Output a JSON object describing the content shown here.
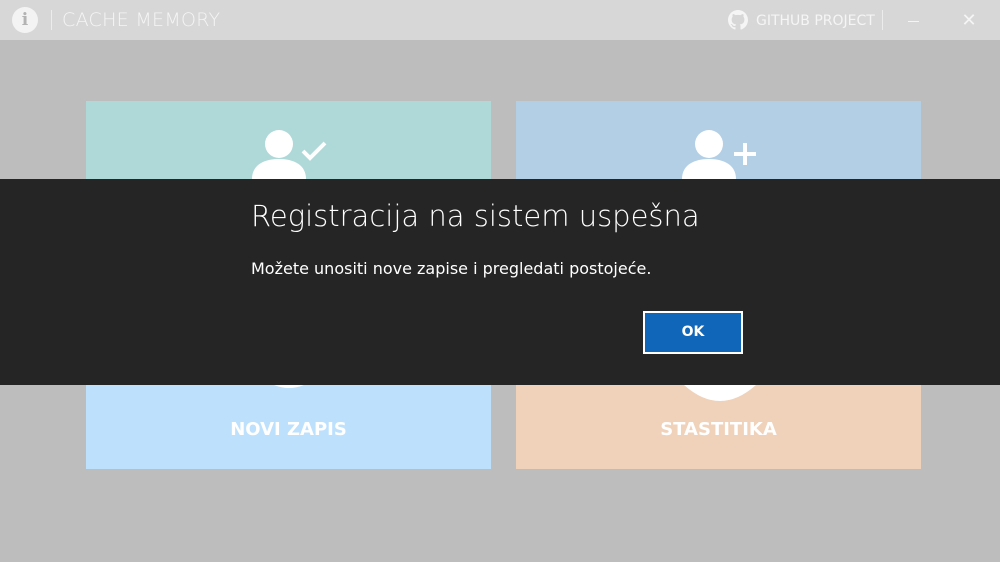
{
  "window": {
    "title": "CACHE MEMORY",
    "info_icon": "info-icon",
    "github_icon": "github-icon",
    "github_label": "GITHUB PROJECT",
    "minimize_icon": "minimize-icon",
    "close_icon": "close-icon",
    "close_glyph": "✕"
  },
  "tiles": [
    {
      "icon": "user-check-icon",
      "label": "",
      "color": "#afd9d8"
    },
    {
      "icon": "user-add-icon",
      "label": "",
      "color": "#b3cfe6"
    },
    {
      "icon": "new-record-icon",
      "label": "NOVI ZAPIS",
      "color": "#bde0fd"
    },
    {
      "icon": "statistics-icon",
      "label": "STASTITIKA",
      "color": "#f0d1b9"
    }
  ],
  "dialog": {
    "title": "Registracija na sistem uspešna",
    "message": "Možete unositi nove zapise i pregledati postojeće.",
    "ok_label": "OK",
    "ok_color": "#1066b8"
  },
  "colors": {
    "background": "#bdbdbd",
    "titlebar": "#d7d7d7",
    "dialog": "#252525"
  }
}
